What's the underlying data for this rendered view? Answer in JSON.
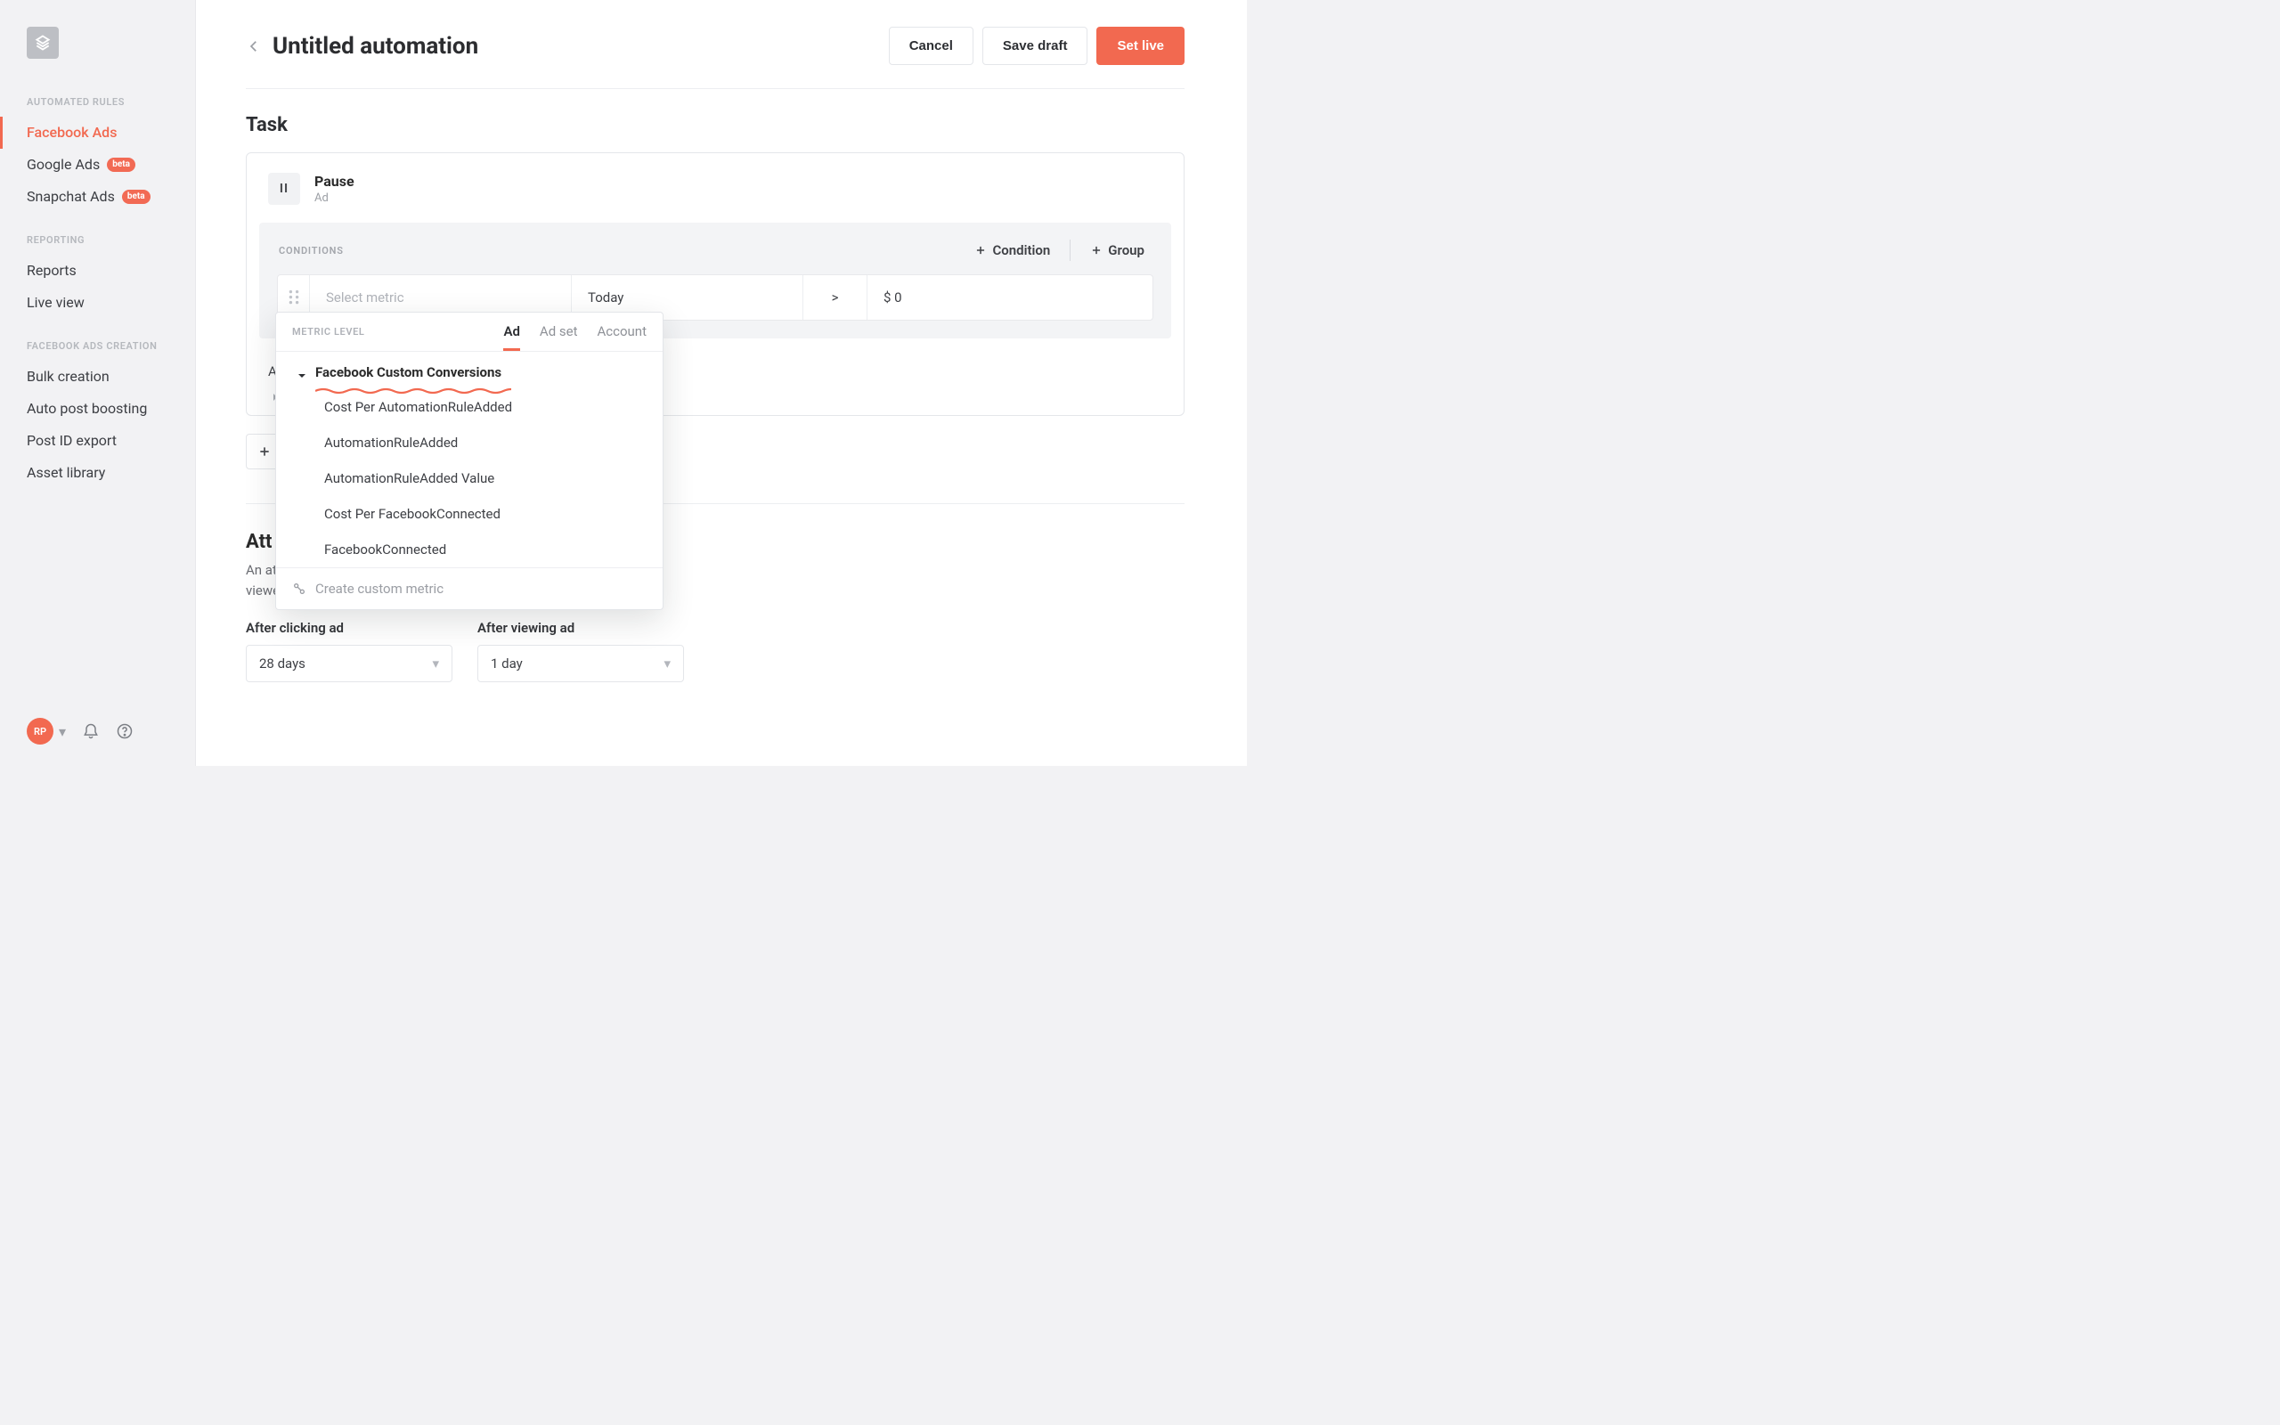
{
  "sidebar": {
    "sections": {
      "automated_rules": {
        "heading": "AUTOMATED RULES"
      },
      "reporting": {
        "heading": "REPORTING"
      },
      "creation": {
        "heading": "FACEBOOK ADS CREATION"
      }
    },
    "facebook_ads": "Facebook Ads",
    "google_ads": "Google Ads",
    "snapchat_ads": "Snapchat Ads",
    "beta": "beta",
    "reports": "Reports",
    "live_view": "Live view",
    "bulk_creation": "Bulk creation",
    "auto_post_boosting": "Auto post boosting",
    "post_id_export": "Post ID export",
    "asset_library": "Asset library",
    "avatar_initials": "RP"
  },
  "header": {
    "title": "Untitled automation",
    "cancel": "Cancel",
    "save_draft": "Save draft",
    "set_live": "Set live"
  },
  "task_section_title": "Task",
  "task": {
    "name": "Pause",
    "level": "Ad"
  },
  "conditions": {
    "label": "CONDITIONS",
    "add_condition": "Condition",
    "add_group": "Group",
    "row": {
      "metric_placeholder": "Select metric",
      "timeframe": "Today",
      "operator": ">",
      "value": "$ 0"
    },
    "action_text": "A"
  },
  "metric_dropdown": {
    "level_label": "METRIC LEVEL",
    "tabs": {
      "ad": "Ad",
      "adset": "Ad set",
      "account": "Account"
    },
    "group_title": "Facebook Custom Conversions",
    "items": {
      "0": "Cost Per AutomationRuleAdded",
      "1": "AutomationRuleAdded",
      "2": "AutomationRuleAdded Value",
      "3": "Cost Per FacebookConnected",
      "4": "FacebookConnected"
    },
    "create_custom": "Create custom metric"
  },
  "attribution": {
    "title_visible": "Att",
    "desc_line1_visible": "An at",
    "desc_line2_visible": "viewe",
    "after_click_label": "After clicking ad",
    "after_view_label": "After viewing ad",
    "after_click_value": "28 days",
    "after_view_value": "1 day"
  }
}
